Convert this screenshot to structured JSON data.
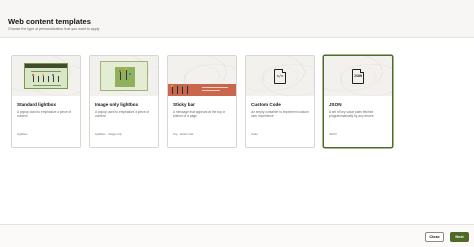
{
  "header": {
    "title": "Web content templates",
    "subtitle": "Choose the type of personalization that you want to apply"
  },
  "cards": [
    {
      "name": "Standard lightbox",
      "description": "A popup used to emphasize a piece of content",
      "tag": "Lightbox",
      "selected": false
    },
    {
      "name": "Image only lightbox",
      "description": "A popup used to emphasize a piece of content",
      "tag": "Lightbox · Image only",
      "selected": false
    },
    {
      "name": "Sticky bar",
      "description": "A message that appears at the top or bottom of a page",
      "tag": "Top · bottom bar",
      "selected": false
    },
    {
      "name": "Custom Code",
      "description": "An empty container to implement custom user experience",
      "tag": "Code",
      "icon_label": "",
      "selected": false
    },
    {
      "name": "JSON",
      "description": "A set of key-value pairs fetched programmatically by any device",
      "tag": "JSON",
      "icon_label": "JSON",
      "selected": true
    }
  ],
  "footer": {
    "close_label": "Close",
    "next_label": "Next"
  },
  "colors": {
    "accent": "#4f6a27",
    "sticky_bar": "#c9674e"
  }
}
